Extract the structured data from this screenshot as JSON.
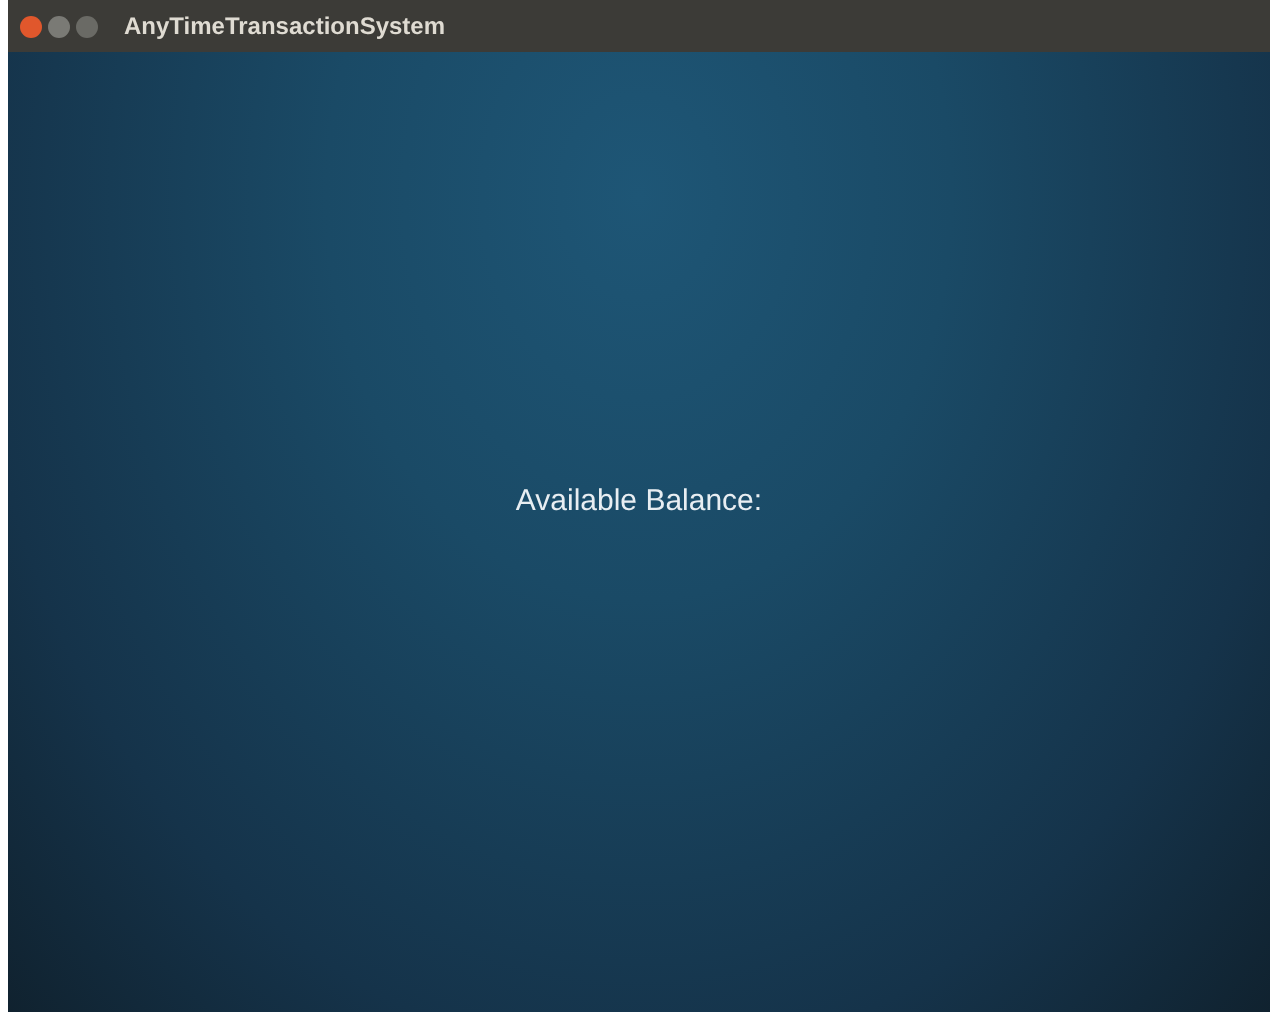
{
  "window": {
    "title": "AnyTimeTransactionSystem"
  },
  "content": {
    "label": "Available Balance:"
  }
}
